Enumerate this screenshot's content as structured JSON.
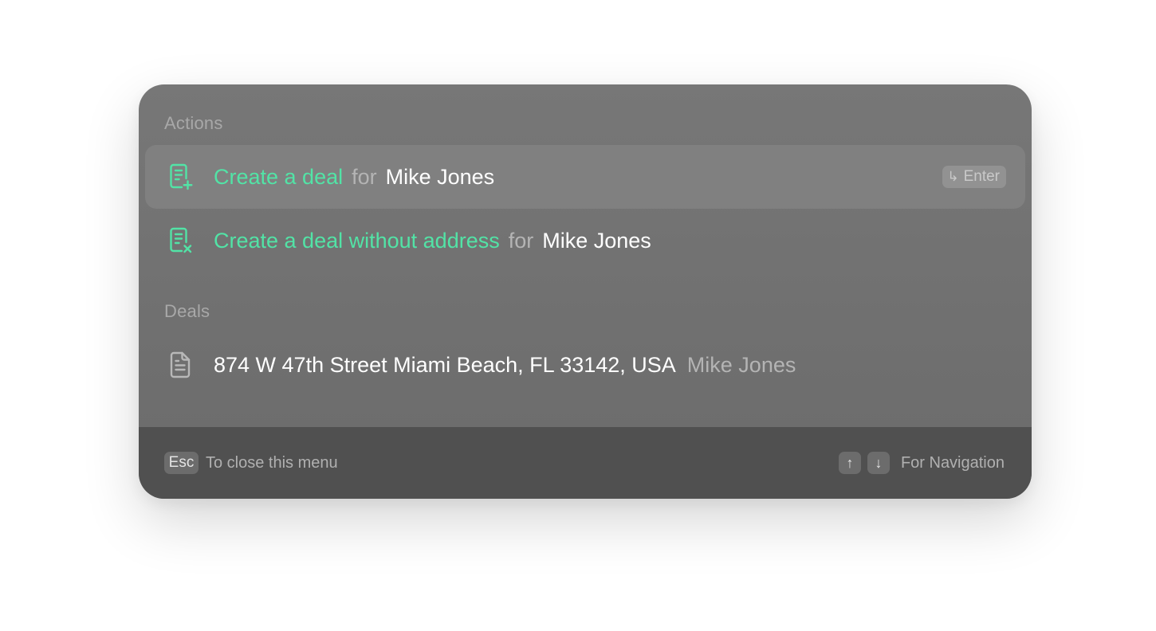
{
  "palette": {
    "actions_title": "Actions",
    "deals_title": "Deals",
    "actions": [
      {
        "icon": "document-plus-icon",
        "label": "Create a deal",
        "connector": "for",
        "contact": "Mike Jones",
        "shortcut_glyph": "↳",
        "shortcut_label": "Enter",
        "selected": true
      },
      {
        "icon": "document-x-icon",
        "label": "Create a deal without address",
        "connector": "for",
        "contact": "Mike Jones",
        "selected": false
      }
    ],
    "deals": [
      {
        "icon": "document-icon",
        "address": "874 W 47th Street Miami Beach, FL 33142, USA",
        "contact": "Mike Jones"
      }
    ],
    "footer": {
      "esc_key": "Esc",
      "esc_text": "To close this menu",
      "up_key": "↑",
      "down_key": "↓",
      "nav_text": "For Navigation"
    }
  },
  "colors": {
    "accent_green": "#52e3a6",
    "panel": "#727272",
    "footer": "#505050",
    "muted_text": "#b4b4b4"
  }
}
